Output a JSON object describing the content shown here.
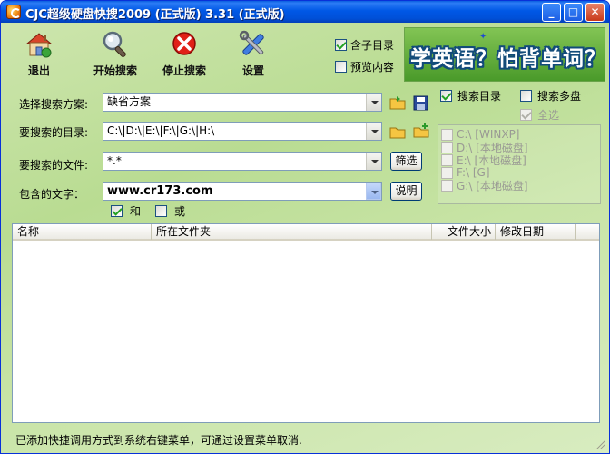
{
  "window": {
    "title": "CJC超级硬盘快搜2009 (正式版) 3.31 (正式版)",
    "controls": {
      "minimize": "_",
      "maximize": "□",
      "close": "✕"
    }
  },
  "toolbar": {
    "exit_label": "退出",
    "start_label": "开始搜索",
    "stop_label": "停止搜索",
    "settings_label": "设置",
    "include_subdir_label": "含子目录",
    "include_subdir_checked": true,
    "preview_label": "预览内容",
    "preview_checked": false
  },
  "banner": {
    "text": "学英语？怕背单词？"
  },
  "form": {
    "scheme_label": "选择搜索方案:",
    "scheme_value": "缺省方案",
    "dirs_label": "要搜索的目录:",
    "dirs_value": "C:\\|D:\\|E:\\|F:\\|G:\\|H:\\",
    "files_label": "要搜索的文件:",
    "files_value": "*.*",
    "filter_button": "筛选",
    "text_label": "包含的文字：",
    "text_value": "www.cr173.com",
    "explain_button": "说明",
    "and_label": "和",
    "and_checked": true,
    "or_label": "或",
    "or_checked": false
  },
  "right_panel": {
    "search_dir_label": "搜索目录",
    "search_dir_checked": true,
    "multi_disk_label": "搜索多盘",
    "multi_disk_checked": false,
    "select_all_label": "全选",
    "drives": [
      "C:\\ [WINXP]",
      "D:\\ [本地磁盘]",
      "E:\\ [本地磁盘]",
      "F:\\ [G]",
      "G:\\ [本地磁盘]"
    ]
  },
  "results": {
    "columns": [
      "名称",
      "所在文件夹",
      "文件大小",
      "修改日期"
    ]
  },
  "status": {
    "text": "已添加快捷调用方式到系统右键菜单，可通过设置菜单取消."
  },
  "colors": {
    "titlebar": "#0058e6",
    "background": "#c8e4a6",
    "banner_bg": "#5aa832"
  }
}
